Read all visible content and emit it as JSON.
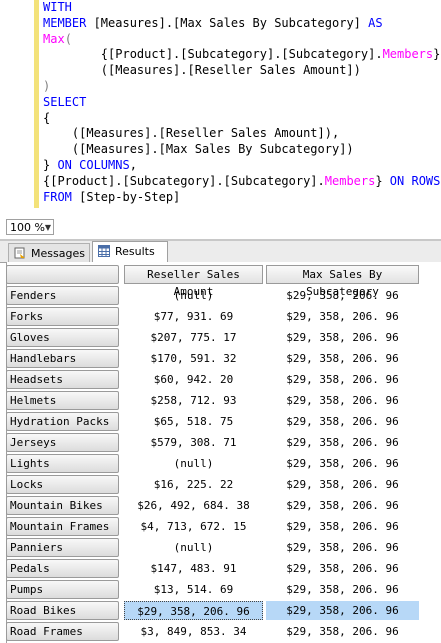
{
  "query_lines": [
    [
      {
        "t": "WITH",
        "c": "kw"
      }
    ],
    [
      {
        "t": "MEMBER ",
        "c": "kw"
      },
      {
        "t": "[Measures].[Max Sales By Subcategory] ",
        "c": ""
      },
      {
        "t": "AS",
        "c": "kw"
      }
    ],
    [
      {
        "t": "Max",
        "c": "fn"
      },
      {
        "t": "(",
        "c": "gr"
      }
    ],
    [
      {
        "t": "        {[Product].[Subcategory].[Subcategory].",
        "c": ""
      },
      {
        "t": "Members",
        "c": "fn"
      },
      {
        "t": "},",
        "c": ""
      }
    ],
    [
      {
        "t": "        ([Measures].[Reseller Sales Amount])",
        "c": ""
      }
    ],
    [
      {
        "t": ")",
        "c": "gr"
      }
    ],
    [
      {
        "t": "SELECT",
        "c": "kw"
      }
    ],
    [
      {
        "t": "{",
        "c": ""
      }
    ],
    [
      {
        "t": "    ([Measures].[Reseller Sales Amount]),",
        "c": ""
      }
    ],
    [
      {
        "t": "    ([Measures].[Max Sales By Subcategory])",
        "c": ""
      }
    ],
    [
      {
        "t": "} ",
        "c": ""
      },
      {
        "t": "ON COLUMNS",
        "c": "kw"
      },
      {
        "t": ",",
        "c": ""
      }
    ],
    [
      {
        "t": "{[Product].[Subcategory].[Subcategory].",
        "c": ""
      },
      {
        "t": "Members",
        "c": "fn"
      },
      {
        "t": "} ",
        "c": ""
      },
      {
        "t": "ON ROWS",
        "c": "kw"
      }
    ],
    [
      {
        "t": "FROM ",
        "c": "kw"
      },
      {
        "t": "[Step-by-Step]",
        "c": ""
      }
    ]
  ],
  "toolbar": {
    "zoom": "100 %"
  },
  "tabs": {
    "messages": "Messages",
    "results": "Results"
  },
  "grid": {
    "columns": [
      "Reseller Sales Amount",
      "Max Sales By Subcategory"
    ],
    "selected_row": "Road Bikes",
    "rows": [
      {
        "label": "Fenders",
        "a": "(null)",
        "b": "$29, 358, 206. 96"
      },
      {
        "label": "Forks",
        "a": "$77, 931. 69",
        "b": "$29, 358, 206. 96"
      },
      {
        "label": "Gloves",
        "a": "$207, 775. 17",
        "b": "$29, 358, 206. 96"
      },
      {
        "label": "Handlebars",
        "a": "$170, 591. 32",
        "b": "$29, 358, 206. 96"
      },
      {
        "label": "Headsets",
        "a": "$60, 942. 20",
        "b": "$29, 358, 206. 96"
      },
      {
        "label": "Helmets",
        "a": "$258, 712. 93",
        "b": "$29, 358, 206. 96"
      },
      {
        "label": "Hydration Packs",
        "a": "$65, 518. 75",
        "b": "$29, 358, 206. 96"
      },
      {
        "label": "Jerseys",
        "a": "$579, 308. 71",
        "b": "$29, 358, 206. 96"
      },
      {
        "label": "Lights",
        "a": "(null)",
        "b": "$29, 358, 206. 96"
      },
      {
        "label": "Locks",
        "a": "$16, 225. 22",
        "b": "$29, 358, 206. 96"
      },
      {
        "label": "Mountain Bikes",
        "a": "$26, 492, 684. 38",
        "b": "$29, 358, 206. 96"
      },
      {
        "label": "Mountain Frames",
        "a": "$4, 713, 672. 15",
        "b": "$29, 358, 206. 96"
      },
      {
        "label": "Panniers",
        "a": "(null)",
        "b": "$29, 358, 206. 96"
      },
      {
        "label": "Pedals",
        "a": "$147, 483. 91",
        "b": "$29, 358, 206. 96"
      },
      {
        "label": "Pumps",
        "a": "$13, 514. 69",
        "b": "$29, 358, 206. 96"
      },
      {
        "label": "Road Bikes",
        "a": "$29, 358, 206. 96",
        "b": "$29, 358, 206. 96"
      },
      {
        "label": "Road Frames",
        "a": "$3, 849, 853. 34",
        "b": "$29, 358, 206. 96"
      }
    ]
  }
}
